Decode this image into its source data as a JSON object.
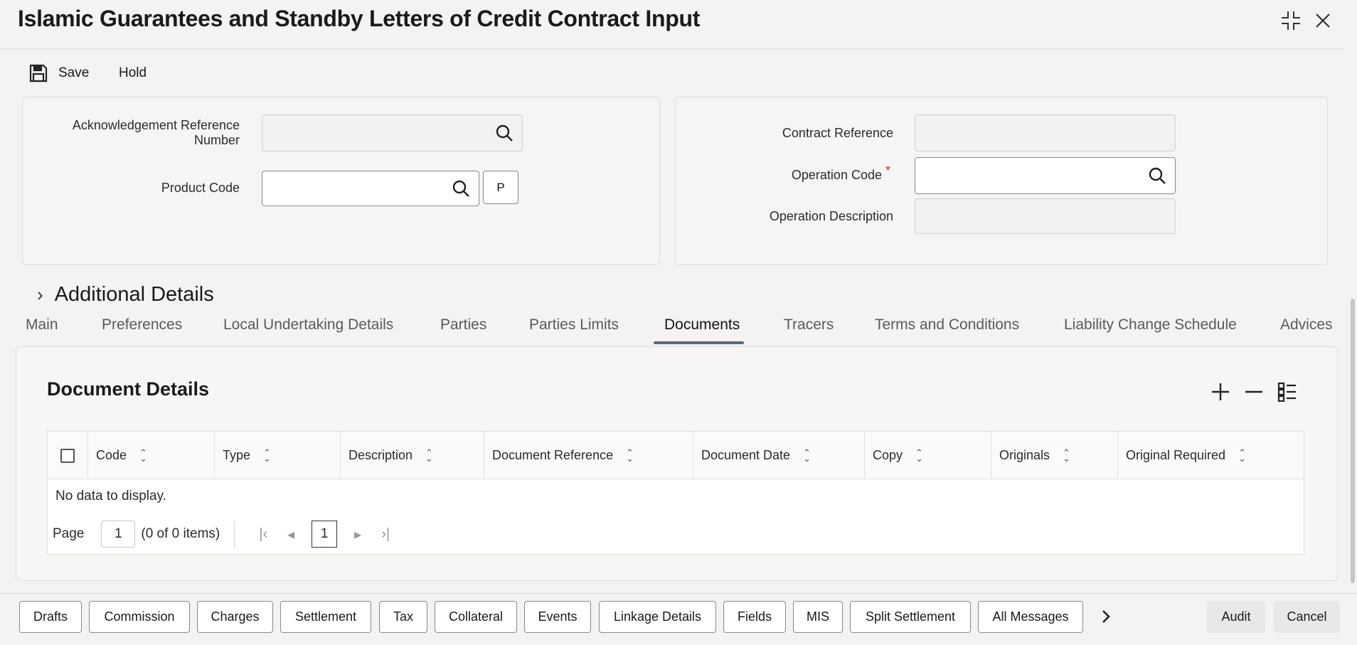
{
  "window": {
    "title": "Islamic Guarantees and Standby Letters of Credit Contract Input"
  },
  "toolbar": {
    "save_label": "Save",
    "hold_label": "Hold"
  },
  "header_left": {
    "ack_ref_label": "Acknowledgement Reference Number",
    "ack_ref_value": "",
    "product_code_label": "Product Code",
    "product_code_value": "",
    "p_button": "P"
  },
  "header_right": {
    "contract_ref_label": "Contract Reference",
    "contract_ref_value": "",
    "operation_code_label": "Operation Code",
    "operation_code_required": "*",
    "operation_code_value": "",
    "operation_desc_label": "Operation Description",
    "operation_desc_value": ""
  },
  "additional_details": {
    "label": "Additional Details"
  },
  "tabs": [
    {
      "label": "Main"
    },
    {
      "label": "Preferences"
    },
    {
      "label": "Local Undertaking Details"
    },
    {
      "label": "Parties"
    },
    {
      "label": "Parties Limits"
    },
    {
      "label": "Documents"
    },
    {
      "label": "Tracers"
    },
    {
      "label": "Terms and Conditions"
    },
    {
      "label": "Liability Change Schedule"
    },
    {
      "label": "Advices"
    }
  ],
  "active_tab": "Documents",
  "documents": {
    "title": "Document Details",
    "columns": [
      "Code",
      "Type",
      "Description",
      "Document Reference",
      "Document Date",
      "Copy",
      "Originals",
      "Original Required"
    ],
    "rows": [],
    "empty_message": "No data to display.",
    "pager": {
      "page_label": "Page",
      "page_value": "1",
      "items_text": "(0 of 0 items)",
      "current_page": "1"
    }
  },
  "footer_buttons": [
    {
      "label": "Drafts"
    },
    {
      "label": "Commission"
    },
    {
      "label": "Charges"
    },
    {
      "label": "Settlement"
    },
    {
      "label": "Tax"
    },
    {
      "label": "Collateral"
    },
    {
      "label": "Events"
    },
    {
      "label": "Linkage Details"
    },
    {
      "label": "Fields"
    },
    {
      "label": "MIS"
    },
    {
      "label": "Split Settlement"
    },
    {
      "label": "All Messages"
    }
  ],
  "footer_right": {
    "audit_label": "Audit",
    "cancel_label": "Cancel"
  },
  "colors": {
    "tab_underline": "#58687a",
    "required": "#c0392b"
  }
}
